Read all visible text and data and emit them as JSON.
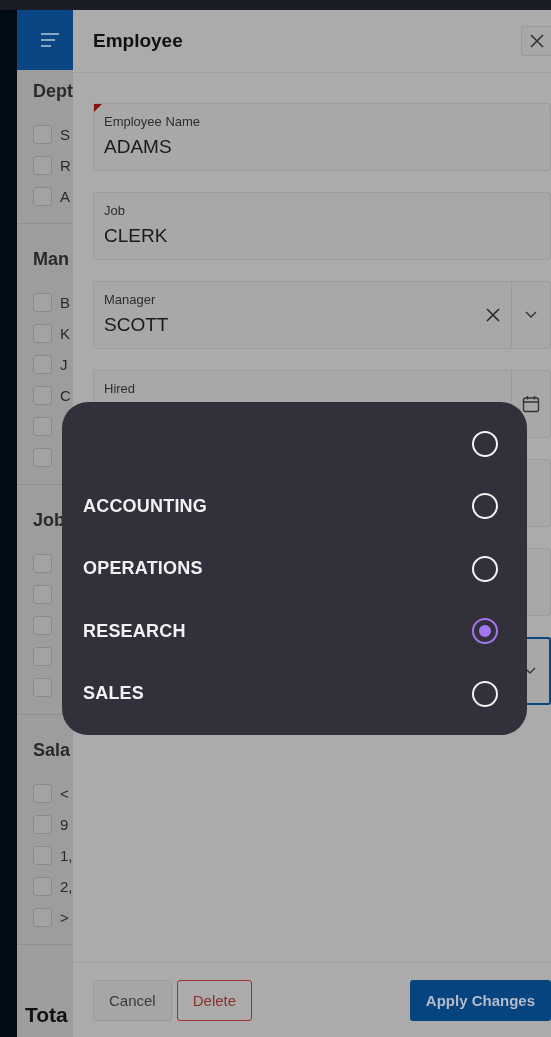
{
  "sidebar": {
    "facets": [
      {
        "title": "Dept",
        "items": [
          {
            "label": "S",
            "checked": false
          },
          {
            "label": "R",
            "checked": false
          },
          {
            "label": "A",
            "checked": false
          }
        ]
      },
      {
        "title": "Man",
        "items": [
          {
            "label": "B",
            "checked": false
          },
          {
            "label": "K",
            "checked": false
          },
          {
            "label": "J",
            "checked": false
          },
          {
            "label": "C",
            "checked": false
          },
          {
            "checked": false
          },
          {
            "checked": false
          }
        ]
      },
      {
        "title": "Job",
        "items": [
          {
            "checked": false
          },
          {
            "checked": false
          },
          {
            "checked": false
          },
          {
            "checked": false
          },
          {
            "checked": false
          }
        ]
      },
      {
        "title": "Sala",
        "items": [
          {
            "label": "<",
            "checked": false
          },
          {
            "label": "9",
            "checked": false
          },
          {
            "label": "1,",
            "checked": false
          },
          {
            "label": "2,",
            "checked": false
          },
          {
            "label": ">",
            "checked": false
          }
        ]
      }
    ],
    "total": "Tota"
  },
  "dialog": {
    "title": "Employee",
    "fields": [
      {
        "kind": "text",
        "label": "Employee Name",
        "value": "ADAMS",
        "required": true,
        "focused": false
      },
      {
        "kind": "text",
        "label": "Job",
        "value": "CLERK",
        "required": false,
        "focused": false
      },
      {
        "kind": "select",
        "label": "Manager",
        "value": "SCOTT",
        "required": false,
        "focused": false
      },
      {
        "kind": "date",
        "label": "Hired",
        "required": false,
        "focused": false
      },
      {
        "kind": "text",
        "focused": false
      },
      {
        "kind": "text",
        "focused": false
      },
      {
        "kind": "select",
        "focused": true
      }
    ],
    "buttons": [
      {
        "label": "Cancel",
        "kind": "plain"
      },
      {
        "label": "Delete",
        "kind": "danger"
      },
      {
        "label": "Apply Changes",
        "kind": "primary"
      }
    ]
  },
  "popup": {
    "options": [
      {
        "selected": false
      },
      {
        "label": "ACCOUNTING",
        "selected": false
      },
      {
        "label": "OPERATIONS",
        "selected": false
      },
      {
        "label": "RESEARCH",
        "selected": true
      },
      {
        "label": "SALES",
        "selected": false
      }
    ]
  }
}
